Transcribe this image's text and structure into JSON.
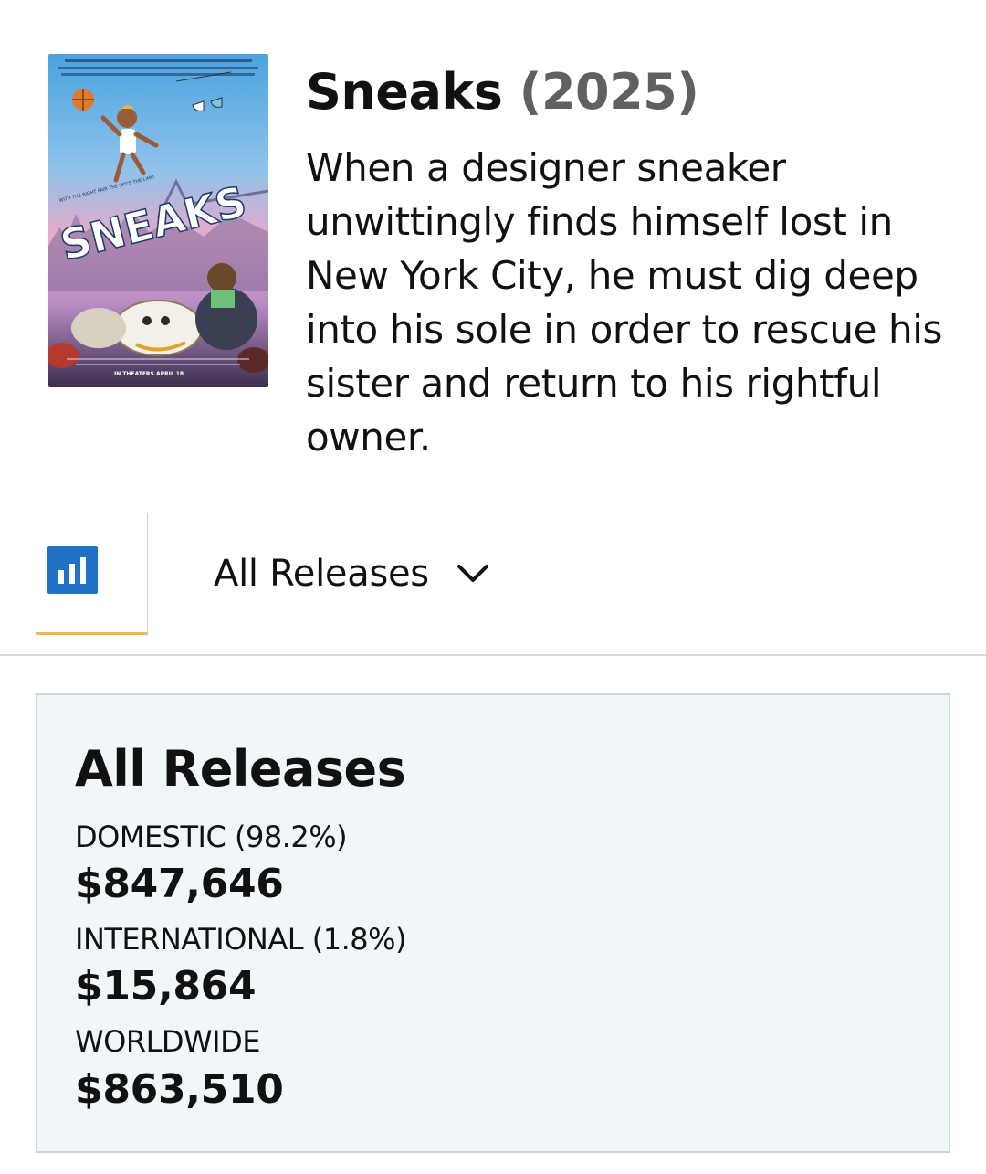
{
  "movie": {
    "title": "Sneaks",
    "year": "(2025)",
    "synopsis": "When a designer sneaker unwittingly finds himself lost in New York City, he must dig deep into his sole in order to rescue his sister and return to his rightful owner.",
    "poster": {
      "title_art": "SNEAKS",
      "tagline": "WITH THE RIGHT PAIR THE SKY'S THE LIMIT",
      "release_note": "IN THEATERS APRIL 18"
    }
  },
  "selector": {
    "chart_icon": "bar-chart-icon",
    "release_label": "All Releases",
    "dropdown_icon": "chevron-down-icon"
  },
  "summary": {
    "heading": "All Releases",
    "domestic_label": "DOMESTIC (98.2%)",
    "domestic_value": "$847,646",
    "international_label": "INTERNATIONAL (1.8%)",
    "international_value": "$15,864",
    "worldwide_label": "WORLDWIDE",
    "worldwide_value": "$863,510"
  },
  "colors": {
    "accent_blue": "#1f72c6",
    "tab_underline": "#e6b85c",
    "summary_bg": "#f1f7f8",
    "year_gray": "#5f6060"
  }
}
